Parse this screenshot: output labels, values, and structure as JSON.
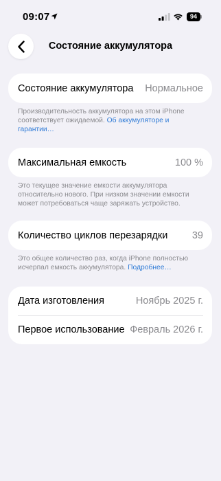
{
  "status_bar": {
    "time": "09:07",
    "battery_level": "94",
    "icons": [
      "location-arrow-icon",
      "cellular-signal-icon",
      "wifi-icon",
      "battery-icon"
    ]
  },
  "nav": {
    "back_icon": "chevron-left-icon",
    "title": "Состояние аккумулятора"
  },
  "battery_health": {
    "label": "Состояние аккумулятора",
    "value": "Нормальное",
    "footnote_text": "Производительность аккумулятора на этом iPhone соответствует ожидаемой. ",
    "footnote_link": "Об аккумуляторе и гарантии…"
  },
  "max_capacity": {
    "label": "Максимальная емкость",
    "value": "100 %",
    "footnote_text": "Это текущее значение емкости аккумулятора относительно нового. При низком значении емкости может потребоваться чаще заряжать устройство."
  },
  "cycle_count": {
    "label": "Количество циклов перезарядки",
    "value": "39",
    "footnote_text": "Это общее количество раз, когда iPhone полностью исчерпал емкость аккумулятора. ",
    "footnote_link": "Подробнее…"
  },
  "dates": {
    "manufacture_label": "Дата изготовления",
    "manufacture_value": "Ноябрь 2025 г.",
    "first_use_label": "Первое использование",
    "first_use_value": "Февраль 2026 г."
  },
  "colors": {
    "background": "#f2f1f7",
    "card": "#ffffff",
    "secondary_text": "#8a8a8e",
    "link": "#2f7bd6"
  }
}
